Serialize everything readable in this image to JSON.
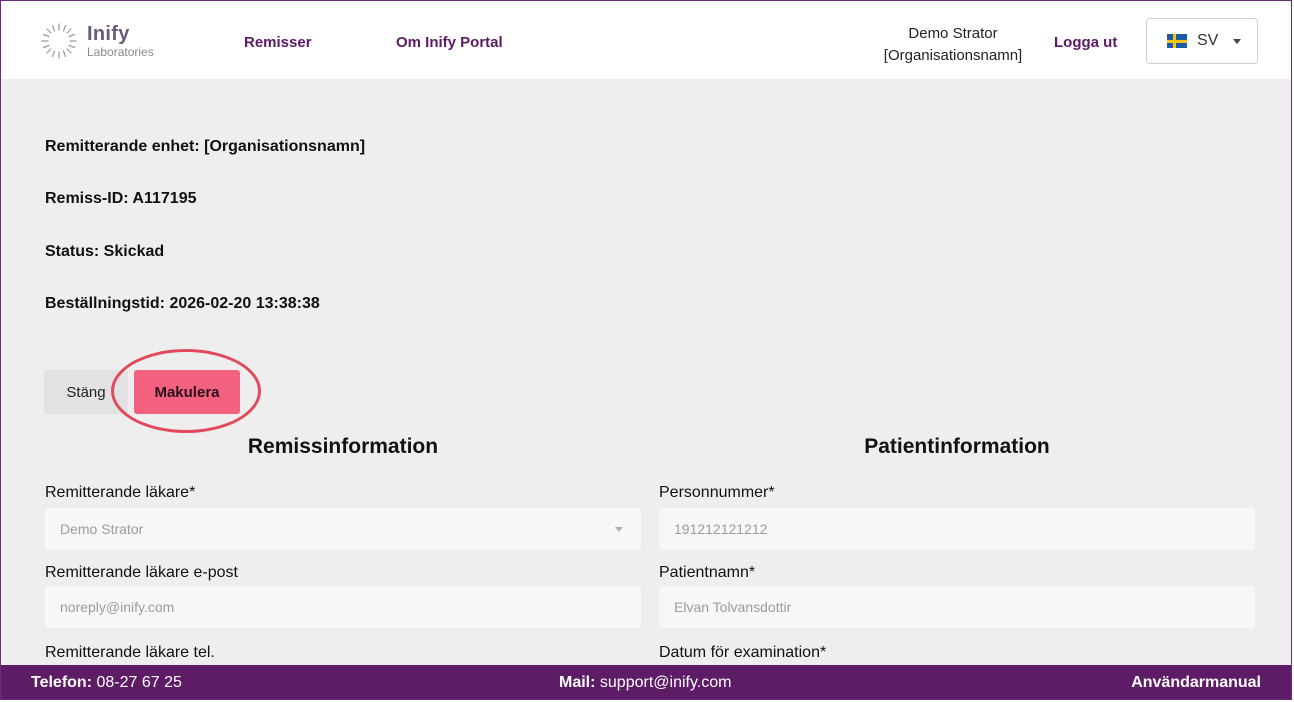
{
  "header": {
    "logo_name": "Inify",
    "logo_sub": "Laboratories",
    "nav": [
      "Remisser",
      "Om Inify Portal"
    ],
    "user_name": "Demo Strator",
    "user_org": "[Organisationsnamn]",
    "logout": "Logga ut",
    "language": "SV",
    "language_icon": "sweden-flag-icon"
  },
  "info": {
    "unit": "Remitterande enhet: [Organisationsnamn]",
    "remiss_id": "Remiss-ID: A117195",
    "status": "Status: Skickad",
    "order_time": "Beställningstid: 2026-02-20 13:38:38"
  },
  "actions": {
    "close": "Stäng",
    "cancel": "Makulera"
  },
  "sections": {
    "left_title": "Remissinformation",
    "right_title": "Patientinformation"
  },
  "left_fields": [
    {
      "label": "Remitterande läkare*",
      "value": "Demo Strator",
      "type": "select"
    },
    {
      "label": "Remitterande läkare e-post",
      "value": "noreply@inify.com",
      "type": "text"
    },
    {
      "label": "Remitterande läkare tel.",
      "value": "",
      "type": "text"
    }
  ],
  "right_fields": [
    {
      "label": "Personnummer*",
      "value": "191212121212",
      "type": "text"
    },
    {
      "label": "Patientnamn*",
      "value": "Elvan Tolvansdottir",
      "type": "text"
    },
    {
      "label": "Datum för examination*",
      "value": "",
      "type": "text"
    }
  ],
  "footer": {
    "phone_label": "Telefon:",
    "phone": "08-27 67 25",
    "mail_label": "Mail:",
    "mail": "support@inify.com",
    "manual": "Användarmanual"
  },
  "colors": {
    "brand_purple": "#5e1b66",
    "danger_pink": "#f2617d",
    "highlight_red": "#e04a5c"
  }
}
